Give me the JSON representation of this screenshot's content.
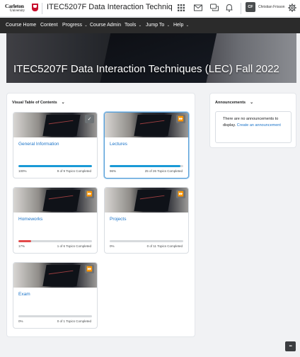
{
  "header": {
    "logo_line1": "Carleton",
    "logo_line2": "University",
    "course_title": "ITEC5207F Data Interaction Techniques (...",
    "user_initials": "CF",
    "user_name": "Christian Frisson"
  },
  "nav": {
    "items": [
      {
        "label": "Course Home",
        "dropdown": false
      },
      {
        "label": "Content",
        "dropdown": false
      },
      {
        "label": "Progress",
        "dropdown": true
      },
      {
        "label": "Course Admin",
        "dropdown": false
      },
      {
        "label": "Tools",
        "dropdown": true
      },
      {
        "label": "Jump To",
        "dropdown": true
      },
      {
        "label": "Help",
        "dropdown": true
      }
    ],
    "caret": "⌄"
  },
  "banner": {
    "title": "ITEC5207F Data Interaction Techniques (LEC) Fall 2022"
  },
  "toc": {
    "header": "Visual Table of Contents",
    "modules": [
      {
        "name": "General Information",
        "percent": "100%",
        "completed": "9 of 9 Topics Completed",
        "progress": 1.0,
        "badge": "check",
        "color": "#1a9ad6"
      },
      {
        "name": "Lectures",
        "percent": "96%",
        "completed": "25 of 26 Topics Completed",
        "progress": 0.96,
        "badge": "forward",
        "color": "#1a9ad6"
      },
      {
        "name": "Homeworks",
        "percent": "17%",
        "completed": "1 of 6 Topics Completed",
        "progress": 0.17,
        "badge": "forward",
        "color": "#e34a4a"
      },
      {
        "name": "Projects",
        "percent": "0%",
        "completed": "0 of 11 Topics Completed",
        "progress": 0,
        "badge": "forward",
        "color": "#1a9ad6"
      },
      {
        "name": "Exam",
        "percent": "0%",
        "completed": "0 of 1 Topics Completed",
        "progress": 0,
        "badge": "forward",
        "color": "#1a9ad6"
      }
    ]
  },
  "announcements": {
    "header": "Announcements",
    "empty_text": "There are no announcements to display.",
    "create_link": "Create an announcement"
  },
  "icons": {
    "check": "✓",
    "forward": "⏩",
    "chevron": "⌄",
    "more": "•••"
  }
}
